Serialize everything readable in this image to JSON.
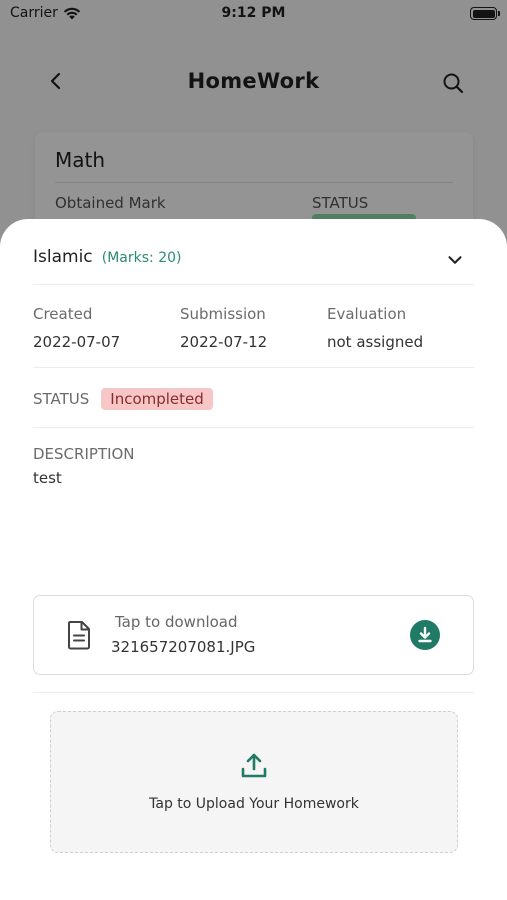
{
  "status_bar": {
    "carrier": "Carrier",
    "time": "9:12 PM"
  },
  "nav": {
    "title": "HomeWork"
  },
  "background_card": {
    "subject": "Math",
    "obtained_label": "Obtained Mark",
    "status_label": "STATUS"
  },
  "sheet": {
    "subject": "Islamic",
    "marks": "(Marks: 20)",
    "info": [
      {
        "label": "Created",
        "value": "2022-07-07"
      },
      {
        "label": "Submission",
        "value": "2022-07-12"
      },
      {
        "label": "Evaluation",
        "value": "not assigned"
      }
    ],
    "status_label": "STATUS",
    "status_value": "Incompleted",
    "description_label": "DESCRIPTION",
    "description_value": "test",
    "download": {
      "label": "Tap to download",
      "file_name": "321657207081.JPG"
    },
    "upload_label": "Tap to Upload Your Homework"
  },
  "colors": {
    "accent": "#1f7a66",
    "marks_text": "#2a8c73",
    "status_badge_bg": "#f7c6c6",
    "status_badge_text": "#8a2b2b"
  },
  "icons": [
    "wifi-icon",
    "battery-icon",
    "back-arrow-icon",
    "search-icon",
    "chevron-down-icon",
    "file-icon",
    "download-icon",
    "upload-icon"
  ]
}
